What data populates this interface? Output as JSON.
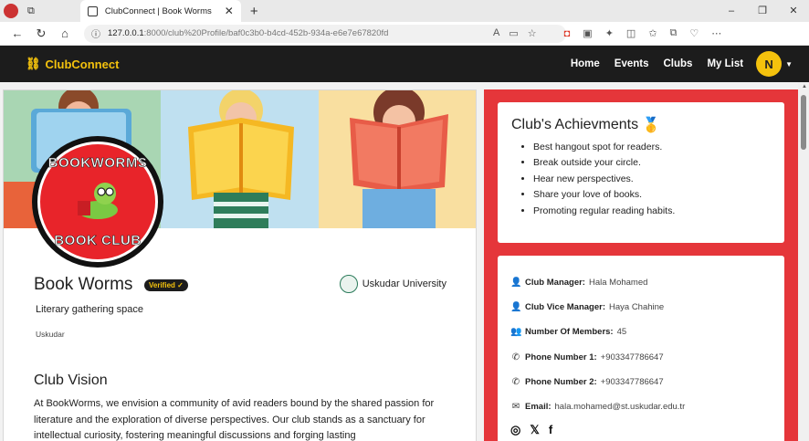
{
  "browser": {
    "tab_title": "ClubConnect | Book Worms",
    "url_host": "127.0.0.1",
    "url_path": ":8000/club%20Profile/baf0c3b0-b4cd-452b-934a-e6e7e67820fd",
    "window_controls": [
      "–",
      "❐",
      "✕"
    ]
  },
  "navbar": {
    "brand": "ClubConnect",
    "links": [
      "Home",
      "Events",
      "Clubs",
      "My List"
    ],
    "avatar_initial": "N"
  },
  "club": {
    "logo_top": "BOOKWORMS",
    "logo_bottom": "BOOK CLUB",
    "name": "Book Worms",
    "verified": "Verified ✓",
    "university": "Uskudar University",
    "subtitle": "Literary gathering space",
    "location": "Uskudar",
    "vision_title": "Club Vision",
    "vision_text": "At BookWorms, we envision a community of avid readers bound by the shared passion for literature and the exploration of diverse perspectives. Our club stands as a sanctuary for intellectual curiosity, fostering meaningful discussions and forging lasting"
  },
  "achievements": {
    "title": "Club's Achievments",
    "items": [
      "Best hangout spot for readers.",
      "Break outside your circle.",
      "Hear new perspectives.",
      "Share your love of books.",
      "Promoting regular reading habits."
    ]
  },
  "info": {
    "manager_label": "Club Manager:",
    "manager": "Hala Mohamed",
    "vice_label": "Club Vice Manager:",
    "vice": "Haya Chahine",
    "members_label": "Number Of Members:",
    "members": "45",
    "phone1_label": "Phone Number 1:",
    "phone1": "+903347786647",
    "phone2_label": "Phone Number 2:",
    "phone2": "+903347786647",
    "email_label": "Email:",
    "email": "hala.mohamed@st.uskudar.edu.tr"
  },
  "colors": {
    "accent": "#f4c20d",
    "panel": "#e5363a",
    "navbar": "#1c1c1c"
  }
}
